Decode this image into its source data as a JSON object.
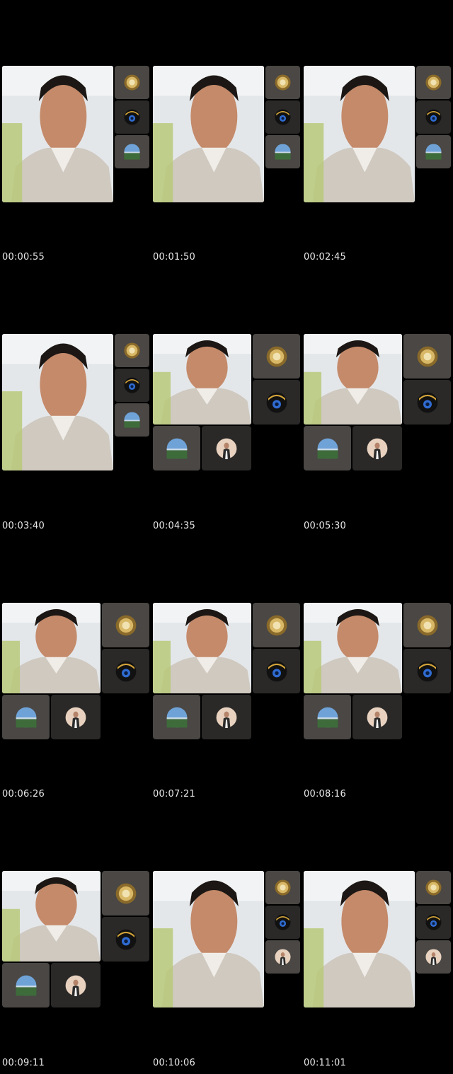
{
  "timestamps": [
    "00:00:55",
    "00:01:50",
    "00:02:45",
    "00:03:40",
    "00:04:35",
    "00:05:30",
    "00:06:26",
    "00:07:21",
    "00:08:16",
    "00:09:11",
    "00:10:06",
    "00:11:01"
  ],
  "frames": [
    {
      "layout": "A",
      "side": [
        "gold-seal-avatar",
        "camera-avatar",
        "landscape-avatar"
      ]
    },
    {
      "layout": "A",
      "side": [
        "gold-seal-avatar",
        "camera-avatar",
        "landscape-avatar"
      ]
    },
    {
      "layout": "A",
      "side": [
        "gold-seal-avatar",
        "camera-avatar",
        "landscape-avatar"
      ]
    },
    {
      "layout": "A",
      "side": [
        "gold-seal-avatar",
        "camera-avatar",
        "landscape-avatar"
      ]
    },
    {
      "layout": "B",
      "side": [
        "gold-seal-avatar",
        "camera-avatar",
        "landscape-avatar",
        "person-avatar"
      ]
    },
    {
      "layout": "B",
      "side": [
        "gold-seal-avatar",
        "camera-avatar",
        "landscape-avatar",
        "person-avatar"
      ]
    },
    {
      "layout": "C",
      "side": [
        "gold-seal-avatar",
        "camera-avatar",
        "landscape-avatar",
        "person-avatar"
      ]
    },
    {
      "layout": "C",
      "side": [
        "gold-seal-avatar",
        "camera-avatar",
        "landscape-avatar",
        "person-avatar"
      ]
    },
    {
      "layout": "C",
      "side": [
        "gold-seal-avatar",
        "camera-avatar",
        "landscape-avatar",
        "person-avatar"
      ]
    },
    {
      "layout": "C",
      "side": [
        "gold-seal-avatar",
        "camera-avatar",
        "landscape-avatar",
        "person-avatar"
      ]
    },
    {
      "layout": "A",
      "side": [
        "gold-seal-avatar",
        "camera-avatar",
        "person-avatar"
      ]
    },
    {
      "layout": "A",
      "side": [
        "gold-seal-avatar",
        "camera-avatar",
        "person-avatar"
      ]
    }
  ],
  "colors": {
    "background": "#000000",
    "timestamp": "#e8e8e8",
    "side_tile": "#4a4744",
    "side_tile_dark": "#2a2928",
    "shirt": "#cfc9c0",
    "skin": "#c48a6a",
    "hair": "#1c1714",
    "wall": "#e4e7ea"
  }
}
